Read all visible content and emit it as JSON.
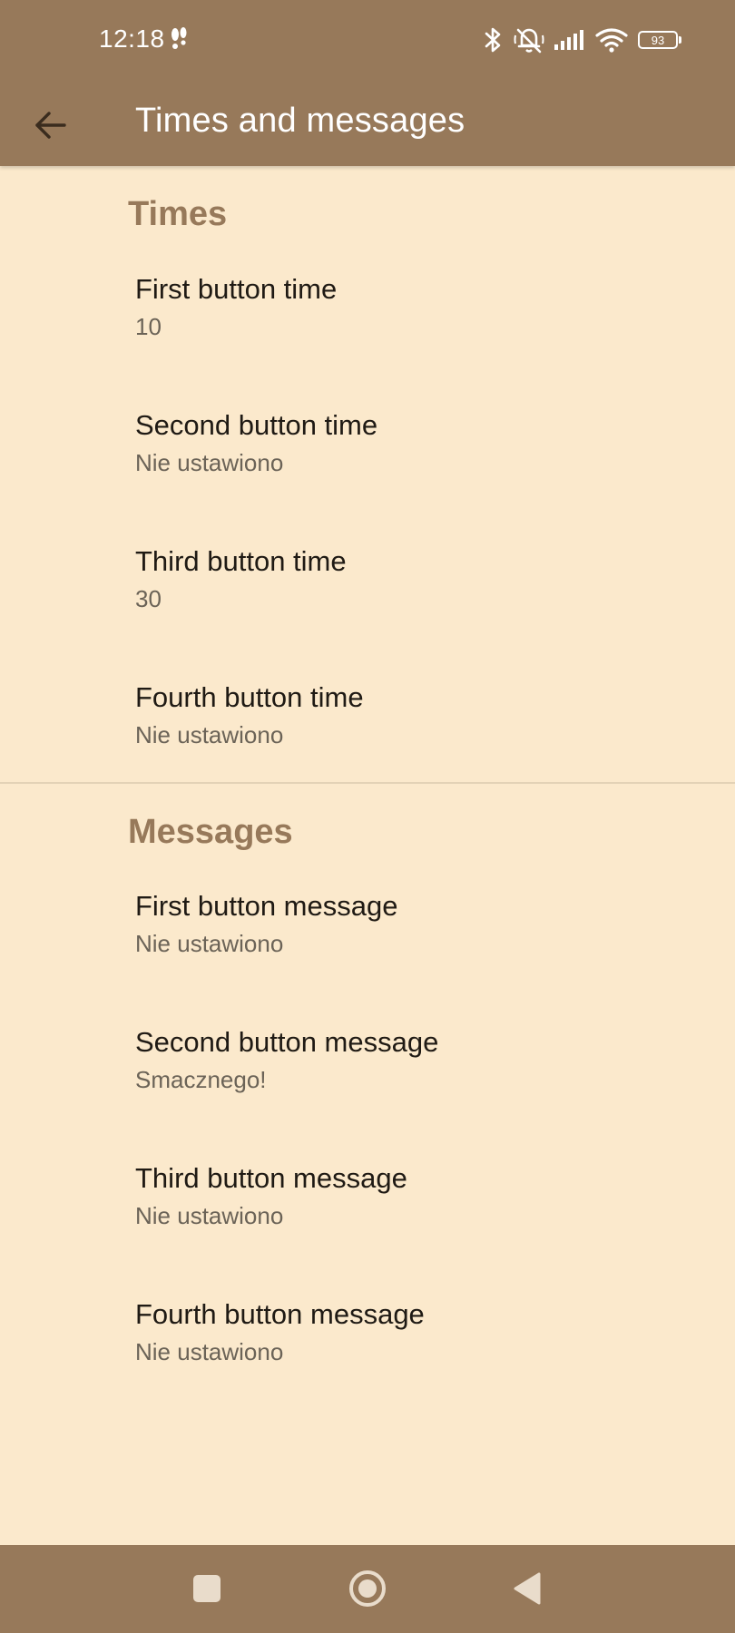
{
  "status_bar": {
    "time": "12:18",
    "battery_level": "93",
    "icons": [
      "walk-icon",
      "bluetooth-icon",
      "muted-bell-icon",
      "signal-icon",
      "wifi-icon",
      "battery-icon"
    ]
  },
  "app_bar": {
    "title": "Times and messages",
    "back_icon": "arrow-left-icon"
  },
  "colors": {
    "app_bar": "#97795A",
    "background": "#FBE9CC",
    "section_header": "#97795A",
    "title_text": "#1F1A14",
    "summary_text": "#6B6357"
  },
  "sections": [
    {
      "header": "Times",
      "items": [
        {
          "title": "First button time",
          "summary": "10"
        },
        {
          "title": "Second button time",
          "summary": "Nie ustawiono"
        },
        {
          "title": "Third button time",
          "summary": "30"
        },
        {
          "title": "Fourth button time",
          "summary": "Nie ustawiono"
        }
      ]
    },
    {
      "header": "Messages",
      "items": [
        {
          "title": "First button message",
          "summary": "Nie ustawiono"
        },
        {
          "title": "Second button message",
          "summary": "Smacznego!"
        },
        {
          "title": "Third button message",
          "summary": "Nie ustawiono"
        },
        {
          "title": "Fourth button message",
          "summary": "Nie ustawiono"
        }
      ]
    }
  ],
  "nav_bar": {
    "buttons": [
      "recents-square-icon",
      "home-circle-icon",
      "back-triangle-icon"
    ]
  }
}
